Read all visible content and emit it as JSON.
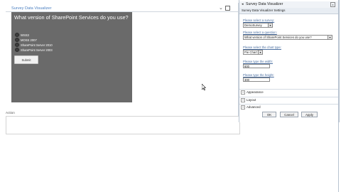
{
  "webpart": {
    "title": "Survey Data Visualizer",
    "question": "What version of SharePoint Services do you use?",
    "options": [
      "WSS3",
      "MOSS 2007",
      "SharePoint Server 2010",
      "SharePoint Server 2003"
    ],
    "submit_label": "Submit",
    "chevron": "⌄"
  },
  "action": {
    "label": "Action"
  },
  "toolpane": {
    "title": "Survey Data Visualizer",
    "close": "x",
    "section_title": "Survey Data Visualizer Settings",
    "survey": {
      "label": "Please select a survey:",
      "value": "DemoSurvey"
    },
    "question": {
      "label": "Please select a question:",
      "value": "What version of SharePoint Services do you use?"
    },
    "chart_type": {
      "label": "Please select the chart type:",
      "value": "Pie Chart"
    },
    "width": {
      "label": "Please type the width:",
      "value": "600"
    },
    "height": {
      "label": "Please type the height:",
      "value": "300"
    },
    "collapsed_sections": [
      "Appearance",
      "Layout",
      "Advanced"
    ],
    "buttons": {
      "ok": "OK",
      "cancel": "Cancel",
      "apply": "Apply"
    }
  },
  "colors": {
    "survey_bg": "#6a6a6a",
    "link_blue": "#4a7fc1",
    "pane_header_bg": "#f0f3f7"
  }
}
